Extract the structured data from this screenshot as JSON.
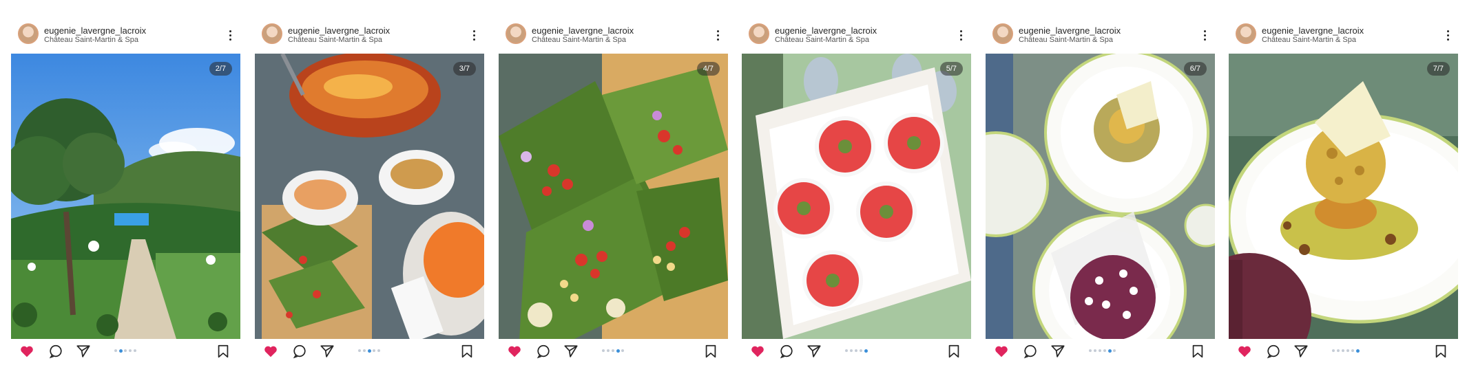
{
  "posts": [
    {
      "username": "eugenie_lavergne_lacroix",
      "location": "Château Saint-Martin & Spa",
      "counter": "2/7",
      "active_dot": 1,
      "total_dots": 7,
      "photo": "garden-path-with-pine-tree",
      "liked": true
    },
    {
      "username": "eugenie_lavergne_lacroix",
      "location": "Château Saint-Martin & Spa",
      "counter": "3/7",
      "active_dot": 2,
      "total_dots": 7,
      "photo": "tagine-and-sauce-boats",
      "liked": true
    },
    {
      "username": "eugenie_lavergne_lacroix",
      "location": "Château Saint-Martin & Spa",
      "counter": "4/7",
      "active_dot": 3,
      "total_dots": 7,
      "photo": "vegetables-in-leaves",
      "liked": true
    },
    {
      "username": "eugenie_lavergne_lacroix",
      "location": "Château Saint-Martin & Spa",
      "counter": "5/7",
      "active_dot": 4,
      "total_dots": 7,
      "photo": "gazpacho-glasses-on-tray",
      "liked": true
    },
    {
      "username": "eugenie_lavergne_lacroix",
      "location": "Château Saint-Martin & Spa",
      "counter": "6/7",
      "active_dot": 5,
      "total_dots": 7,
      "photo": "desserts-on-plates",
      "liked": true
    },
    {
      "username": "eugenie_lavergne_lacroix",
      "location": "Château Saint-Martin & Spa",
      "counter": "7/7",
      "active_dot": 6,
      "total_dots": 7,
      "photo": "dessert-dome-close-up",
      "liked": true
    }
  ],
  "icons": {
    "like": "heart-icon",
    "comment": "comment-icon",
    "share": "paper-plane-icon",
    "save": "bookmark-icon",
    "more": "more-options-icon"
  },
  "colors": {
    "like": "#e0245e",
    "dot_active": "#3b8fd9",
    "dot_inactive": "#c5ccd6",
    "text": "#262626"
  }
}
